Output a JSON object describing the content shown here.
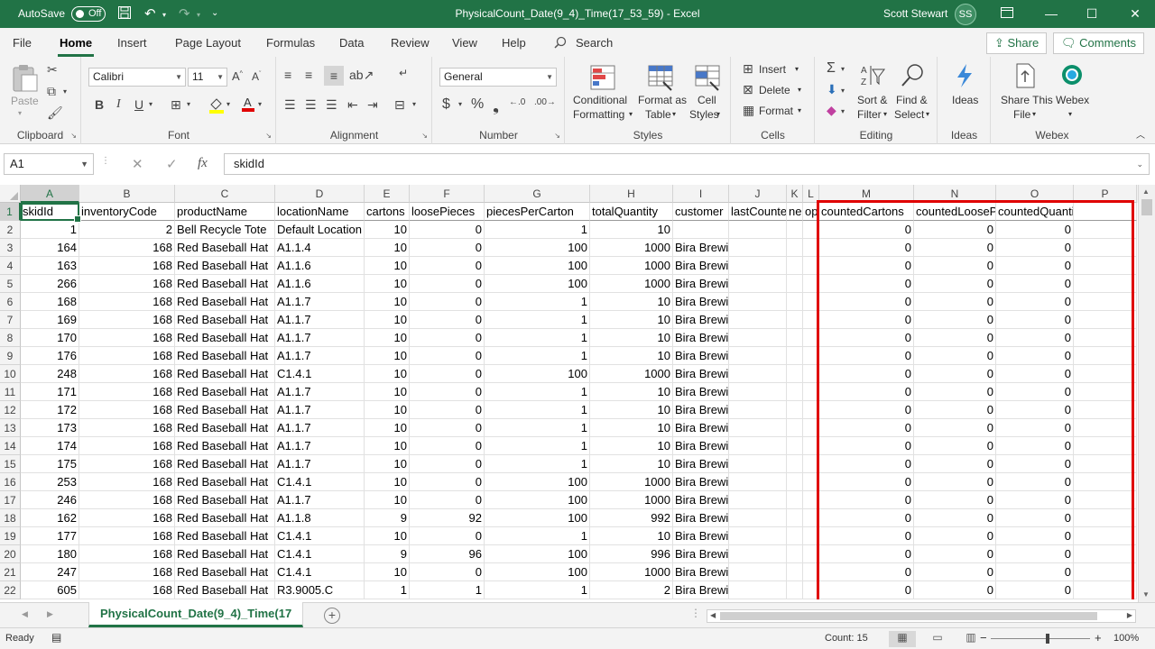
{
  "titlebar": {
    "autosave_label": "AutoSave",
    "autosave_state": "Off",
    "title": "PhysicalCount_Date(9_4)_Time(17_53_59)  -  Excel",
    "user_name": "Scott Stewart",
    "user_initials": "SS"
  },
  "tabs": [
    "File",
    "Home",
    "Insert",
    "Page Layout",
    "Formulas",
    "Data",
    "Review",
    "View",
    "Help"
  ],
  "search_label": "Search",
  "share_label": "Share",
  "comments_label": "Comments",
  "ribbon": {
    "clipboard": {
      "label": "Clipboard",
      "paste": "Paste"
    },
    "font": {
      "label": "Font",
      "font_name": "Calibri",
      "font_size": "11"
    },
    "alignment": {
      "label": "Alignment"
    },
    "number": {
      "label": "Number",
      "format": "General"
    },
    "styles": {
      "label": "Styles",
      "conditional": "Conditional",
      "formatting": "Formatting",
      "format_as": "Format as",
      "table": "Table",
      "cell": "Cell",
      "cell_styles": "Styles"
    },
    "cells": {
      "label": "Cells",
      "insert": "Insert",
      "delete": "Delete",
      "format": "Format"
    },
    "editing": {
      "label": "Editing",
      "sort": "Sort &",
      "filter": "Filter",
      "find": "Find &",
      "select": "Select"
    },
    "ideas": {
      "label": "Ideas",
      "button": "Ideas"
    },
    "webex": {
      "label": "Webex",
      "share_this": "Share This",
      "file": "File",
      "webex_btn": "Webex"
    }
  },
  "formula_bar": {
    "name_box": "A1",
    "formula": "skidId"
  },
  "columns": [
    {
      "letter": "A"
    },
    {
      "letter": "B"
    },
    {
      "letter": "C"
    },
    {
      "letter": "D"
    },
    {
      "letter": "E"
    },
    {
      "letter": "F"
    },
    {
      "letter": "G"
    },
    {
      "letter": "H"
    },
    {
      "letter": "I"
    },
    {
      "letter": "J"
    },
    {
      "letter": "K"
    },
    {
      "letter": "L"
    },
    {
      "letter": "M"
    },
    {
      "letter": "N"
    },
    {
      "letter": "O"
    },
    {
      "letter": "P"
    }
  ],
  "header_row": [
    "skidId",
    "inventoryCode",
    "productName",
    "locationName",
    "cartons",
    "loosePieces",
    "piecesPerCarton",
    "totalQuantity",
    "customer",
    "lastCounted",
    "ne",
    "op",
    "countedCartons",
    "countedLoosePieces",
    "countedQuantity",
    ""
  ],
  "rows": [
    [
      "1",
      "2",
      "Bell Recycle Tote",
      "Default Location",
      "10",
      "0",
      "1",
      "10",
      "",
      "",
      "",
      "",
      "0",
      "0",
      "0",
      ""
    ],
    [
      "164",
      "168",
      "Red Baseball Hat",
      "A1.1.4",
      "10",
      "0",
      "100",
      "1000",
      "Bira Brewing",
      "",
      "",
      "",
      "0",
      "0",
      "0",
      ""
    ],
    [
      "163",
      "168",
      "Red Baseball Hat",
      "A1.1.6",
      "10",
      "0",
      "100",
      "1000",
      "Bira Brewing",
      "",
      "",
      "",
      "0",
      "0",
      "0",
      ""
    ],
    [
      "266",
      "168",
      "Red Baseball Hat",
      "A1.1.6",
      "10",
      "0",
      "100",
      "1000",
      "Bira Brewing",
      "",
      "",
      "",
      "0",
      "0",
      "0",
      ""
    ],
    [
      "168",
      "168",
      "Red Baseball Hat",
      "A1.1.7",
      "10",
      "0",
      "1",
      "10",
      "Bira Brewing",
      "",
      "",
      "",
      "0",
      "0",
      "0",
      ""
    ],
    [
      "169",
      "168",
      "Red Baseball Hat",
      "A1.1.7",
      "10",
      "0",
      "1",
      "10",
      "Bira Brewing",
      "",
      "",
      "",
      "0",
      "0",
      "0",
      ""
    ],
    [
      "170",
      "168",
      "Red Baseball Hat",
      "A1.1.7",
      "10",
      "0",
      "1",
      "10",
      "Bira Brewing",
      "",
      "",
      "",
      "0",
      "0",
      "0",
      ""
    ],
    [
      "176",
      "168",
      "Red Baseball Hat",
      "A1.1.7",
      "10",
      "0",
      "1",
      "10",
      "Bira Brewing",
      "",
      "",
      "",
      "0",
      "0",
      "0",
      ""
    ],
    [
      "248",
      "168",
      "Red Baseball Hat",
      "C1.4.1",
      "10",
      "0",
      "100",
      "1000",
      "Bira Brewing",
      "",
      "",
      "",
      "0",
      "0",
      "0",
      ""
    ],
    [
      "171",
      "168",
      "Red Baseball Hat",
      "A1.1.7",
      "10",
      "0",
      "1",
      "10",
      "Bira Brewing",
      "",
      "",
      "",
      "0",
      "0",
      "0",
      ""
    ],
    [
      "172",
      "168",
      "Red Baseball Hat",
      "A1.1.7",
      "10",
      "0",
      "1",
      "10",
      "Bira Brewing",
      "",
      "",
      "",
      "0",
      "0",
      "0",
      ""
    ],
    [
      "173",
      "168",
      "Red Baseball Hat",
      "A1.1.7",
      "10",
      "0",
      "1",
      "10",
      "Bira Brewing",
      "",
      "",
      "",
      "0",
      "0",
      "0",
      ""
    ],
    [
      "174",
      "168",
      "Red Baseball Hat",
      "A1.1.7",
      "10",
      "0",
      "1",
      "10",
      "Bira Brewing",
      "",
      "",
      "",
      "0",
      "0",
      "0",
      ""
    ],
    [
      "175",
      "168",
      "Red Baseball Hat",
      "A1.1.7",
      "10",
      "0",
      "1",
      "10",
      "Bira Brewing",
      "",
      "",
      "",
      "0",
      "0",
      "0",
      ""
    ],
    [
      "253",
      "168",
      "Red Baseball Hat",
      "C1.4.1",
      "10",
      "0",
      "100",
      "1000",
      "Bira Brewing",
      "",
      "",
      "",
      "0",
      "0",
      "0",
      ""
    ],
    [
      "246",
      "168",
      "Red Baseball Hat",
      "A1.1.7",
      "10",
      "0",
      "100",
      "1000",
      "Bira Brewing",
      "",
      "",
      "",
      "0",
      "0",
      "0",
      ""
    ],
    [
      "162",
      "168",
      "Red Baseball Hat",
      "A1.1.8",
      "9",
      "92",
      "100",
      "992",
      "Bira Brewing",
      "",
      "",
      "",
      "0",
      "0",
      "0",
      ""
    ],
    [
      "177",
      "168",
      "Red Baseball Hat",
      "C1.4.1",
      "10",
      "0",
      "1",
      "10",
      "Bira Brewing",
      "",
      "",
      "",
      "0",
      "0",
      "0",
      ""
    ],
    [
      "180",
      "168",
      "Red Baseball Hat",
      "C1.4.1",
      "9",
      "96",
      "100",
      "996",
      "Bira Brewing",
      "",
      "",
      "",
      "0",
      "0",
      "0",
      ""
    ],
    [
      "247",
      "168",
      "Red Baseball Hat",
      "C1.4.1",
      "10",
      "0",
      "100",
      "1000",
      "Bira Brewing",
      "",
      "",
      "",
      "0",
      "0",
      "0",
      ""
    ],
    [
      "605",
      "168",
      "Red Baseball Hat",
      "R3.9005.C",
      "1",
      "1",
      "1",
      "2",
      "Bira Brewing",
      "",
      "",
      "",
      "0",
      "0",
      "0",
      ""
    ]
  ],
  "numeric_columns": [
    0,
    1,
    4,
    5,
    6,
    7,
    12,
    13,
    14
  ],
  "sheet_tab": "PhysicalCount_Date(9_4)_Time(17",
  "status": {
    "ready": "Ready",
    "count": "Count: 15",
    "zoom": "100%"
  },
  "colors": {
    "excel_green": "#217346",
    "highlight_red": "#e00000"
  }
}
